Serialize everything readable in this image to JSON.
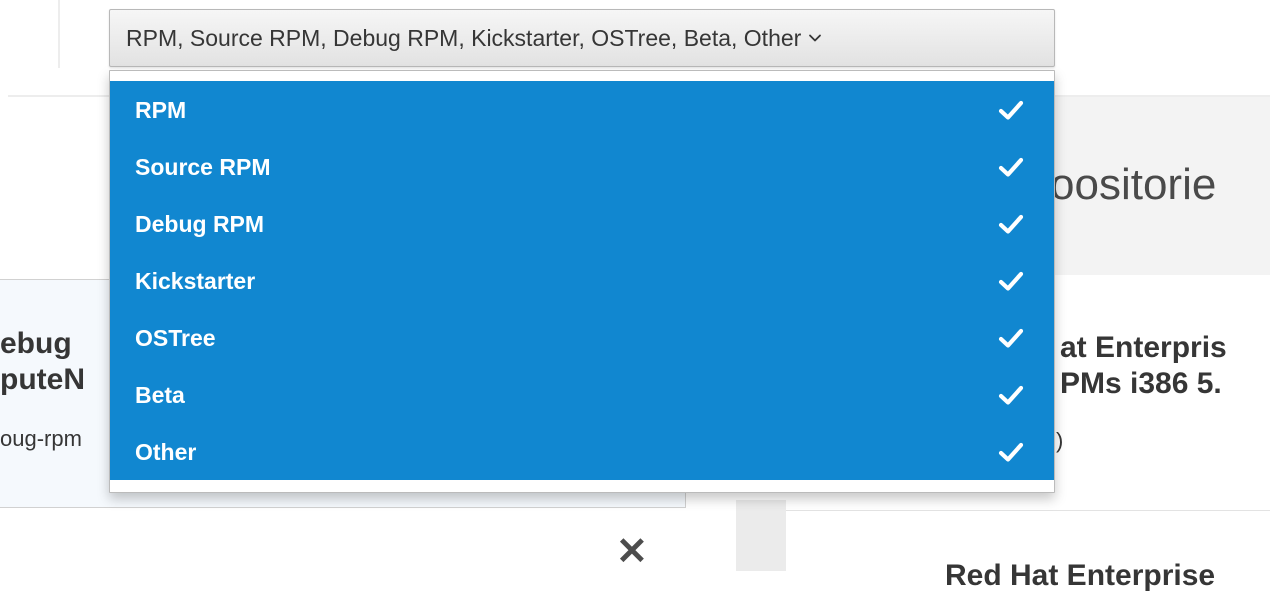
{
  "background": {
    "left_card": {
      "title_line1": "ebug",
      "title_line2": "puteN",
      "subtitle": "oug-rpm"
    },
    "right_panel": {
      "heading": "oositorie",
      "item_title_line1": "at Enterpris",
      "item_title_line2": "PMs i386 5.",
      "item_subtitle": ")",
      "next_item_title": "Red Hat Enterprise"
    },
    "close_glyph": "✕"
  },
  "dropdown": {
    "selected_summary": "RPM, Source RPM, Debug RPM, Kickstarter, OSTree, Beta, Other",
    "caret_icon": "chevron-down-icon",
    "options": [
      {
        "label": "RPM",
        "checked": true
      },
      {
        "label": "Source RPM",
        "checked": true
      },
      {
        "label": "Debug RPM",
        "checked": true
      },
      {
        "label": "Kickstarter",
        "checked": true
      },
      {
        "label": "OSTree",
        "checked": true
      },
      {
        "label": "Beta",
        "checked": true
      },
      {
        "label": "Other",
        "checked": true
      }
    ]
  },
  "colors": {
    "selected_bg": "#1187d0",
    "selected_text": "#ffffff",
    "toggle_bg": "#eeeeee"
  }
}
